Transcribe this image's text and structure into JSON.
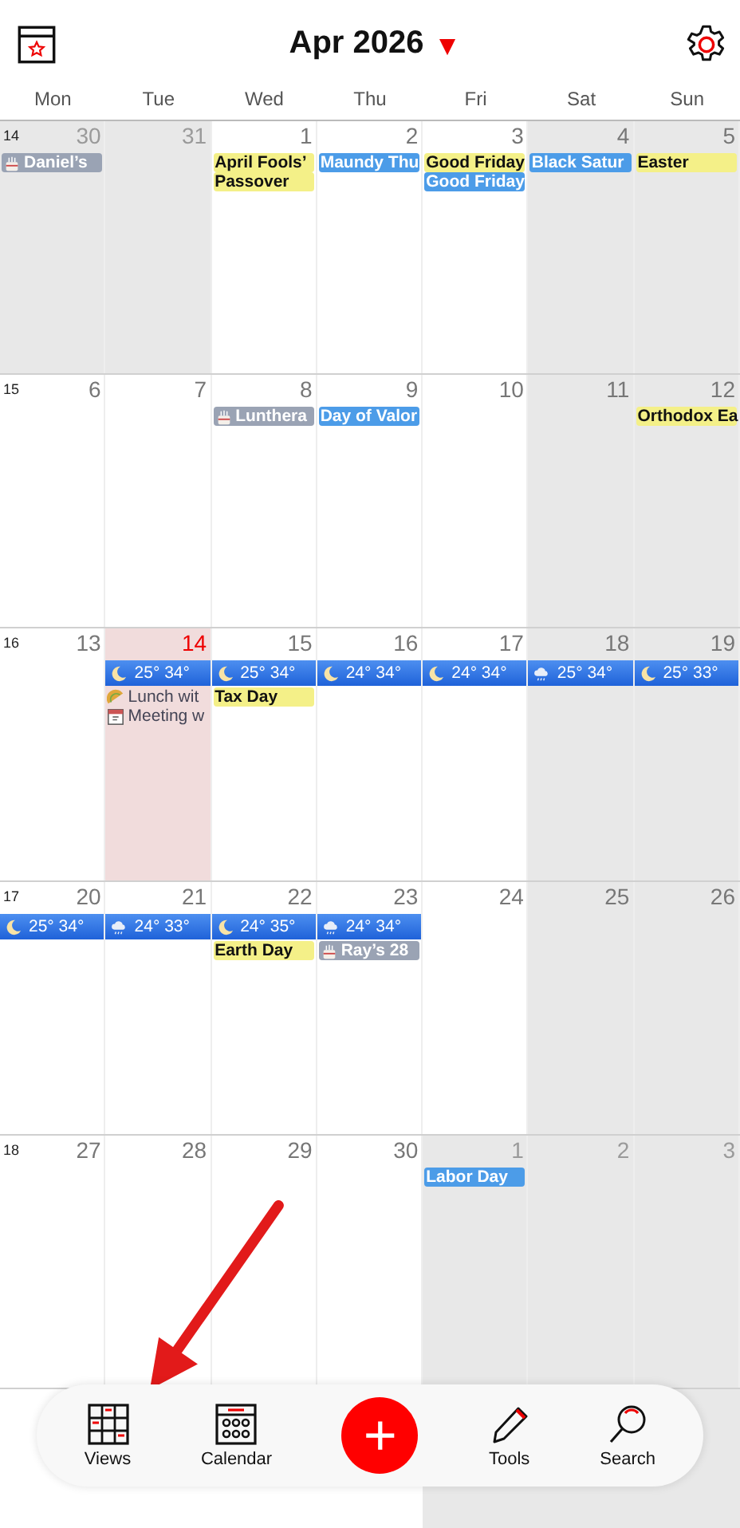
{
  "header": {
    "title": "Apr 2026",
    "caret": "▾"
  },
  "weekdays": [
    "Mon",
    "Tue",
    "Wed",
    "Thu",
    "Fri",
    "Sat",
    "Sun"
  ],
  "weeks": [
    {
      "number": "14",
      "days": [
        {
          "day": "30",
          "outside": true,
          "today": false,
          "events": [
            {
              "kind": "birthday",
              "text": "Daniel’s"
            }
          ]
        },
        {
          "day": "31",
          "outside": true,
          "today": false
        },
        {
          "day": "1",
          "outside": false,
          "today": false,
          "events": [
            {
              "kind": "holiday",
              "text": "April Fools’"
            },
            {
              "kind": "holiday",
              "text": "Passover"
            }
          ]
        },
        {
          "day": "2",
          "outside": false,
          "today": false,
          "events": [
            {
              "kind": "observance",
              "text": "Maundy Thu"
            }
          ]
        },
        {
          "day": "3",
          "outside": false,
          "today": false,
          "events": [
            {
              "kind": "holiday",
              "text": "Good Friday"
            },
            {
              "kind": "observance",
              "text": "Good Friday"
            }
          ]
        },
        {
          "day": "4",
          "outside": false,
          "today": false,
          "events": [
            {
              "kind": "observance",
              "text": "Black Satur"
            }
          ]
        },
        {
          "day": "5",
          "outside": false,
          "today": false,
          "events": [
            {
              "kind": "holiday",
              "text": "Easter"
            }
          ]
        }
      ]
    },
    {
      "number": "15",
      "days": [
        {
          "day": "6",
          "outside": false,
          "today": false
        },
        {
          "day": "7",
          "outside": false,
          "today": false
        },
        {
          "day": "8",
          "outside": false,
          "today": false,
          "events": [
            {
              "kind": "birthday",
              "text": "Lunthera"
            }
          ]
        },
        {
          "day": "9",
          "outside": false,
          "today": false,
          "events": [
            {
              "kind": "observance",
              "text": "Day of Valor"
            }
          ]
        },
        {
          "day": "10",
          "outside": false,
          "today": false
        },
        {
          "day": "11",
          "outside": false,
          "today": false
        },
        {
          "day": "12",
          "outside": false,
          "today": false,
          "events": [
            {
              "kind": "holiday",
              "text": "Orthodox Ea"
            }
          ]
        }
      ]
    },
    {
      "number": "16",
      "days": [
        {
          "day": "13",
          "outside": false,
          "today": false
        },
        {
          "day": "14",
          "outside": false,
          "today": true,
          "events": [
            {
              "kind": "clear",
              "text": "25° 34°"
            },
            {
              "kind": "lunch",
              "text": "Lunch wit"
            },
            {
              "kind": "meeting",
              "text": "Meeting w"
            }
          ]
        },
        {
          "day": "15",
          "outside": false,
          "today": false,
          "events": [
            {
              "kind": "clear",
              "text": "25° 34°"
            },
            {
              "kind": "holiday",
              "text": "Tax Day"
            }
          ]
        },
        {
          "day": "16",
          "outside": false,
          "today": false,
          "events": [
            {
              "kind": "clear",
              "text": "24° 34°"
            }
          ]
        },
        {
          "day": "17",
          "outside": false,
          "today": false,
          "events": [
            {
              "kind": "clear",
              "text": "24° 34°"
            }
          ]
        },
        {
          "day": "18",
          "outside": false,
          "today": false,
          "events": [
            {
              "kind": "rain",
              "text": "25° 34°"
            }
          ]
        },
        {
          "day": "19",
          "outside": false,
          "today": false,
          "events": [
            {
              "kind": "clear",
              "text": "25° 33°"
            }
          ]
        }
      ]
    },
    {
      "number": "17",
      "days": [
        {
          "day": "20",
          "outside": false,
          "today": false,
          "events": [
            {
              "kind": "clear",
              "text": "25° 34°"
            }
          ]
        },
        {
          "day": "21",
          "outside": false,
          "today": false,
          "events": [
            {
              "kind": "rain",
              "text": "24° 33°"
            }
          ]
        },
        {
          "day": "22",
          "outside": false,
          "today": false,
          "events": [
            {
              "kind": "clear",
              "text": "24° 35°"
            },
            {
              "kind": "holiday",
              "text": "Earth Day"
            }
          ]
        },
        {
          "day": "23",
          "outside": false,
          "today": false,
          "events": [
            {
              "kind": "rain",
              "text": "24° 34°"
            },
            {
              "kind": "birthday",
              "text": "Ray’s 28"
            }
          ]
        },
        {
          "day": "24",
          "outside": false,
          "today": false
        },
        {
          "day": "25",
          "outside": false,
          "today": false
        },
        {
          "day": "26",
          "outside": false,
          "today": false
        }
      ]
    },
    {
      "number": "18",
      "days": [
        {
          "day": "27",
          "outside": false,
          "today": false
        },
        {
          "day": "28",
          "outside": false,
          "today": false
        },
        {
          "day": "29",
          "outside": false,
          "today": false
        },
        {
          "day": "30",
          "outside": false,
          "today": false
        },
        {
          "day": "1",
          "outside": true,
          "today": false,
          "events": [
            {
              "kind": "observance",
              "text": "Labor Day"
            }
          ]
        },
        {
          "day": "2",
          "outside": true,
          "today": false
        },
        {
          "day": "3",
          "outside": true,
          "today": false
        }
      ]
    }
  ],
  "toolbar": [
    {
      "kind": "views",
      "label": "Views"
    },
    {
      "kind": "calendar",
      "label": "Calendar"
    },
    {
      "kind": "add",
      "label": "+"
    },
    {
      "kind": "tools",
      "label": "Tools"
    },
    {
      "kind": "search",
      "label": "Search"
    }
  ]
}
